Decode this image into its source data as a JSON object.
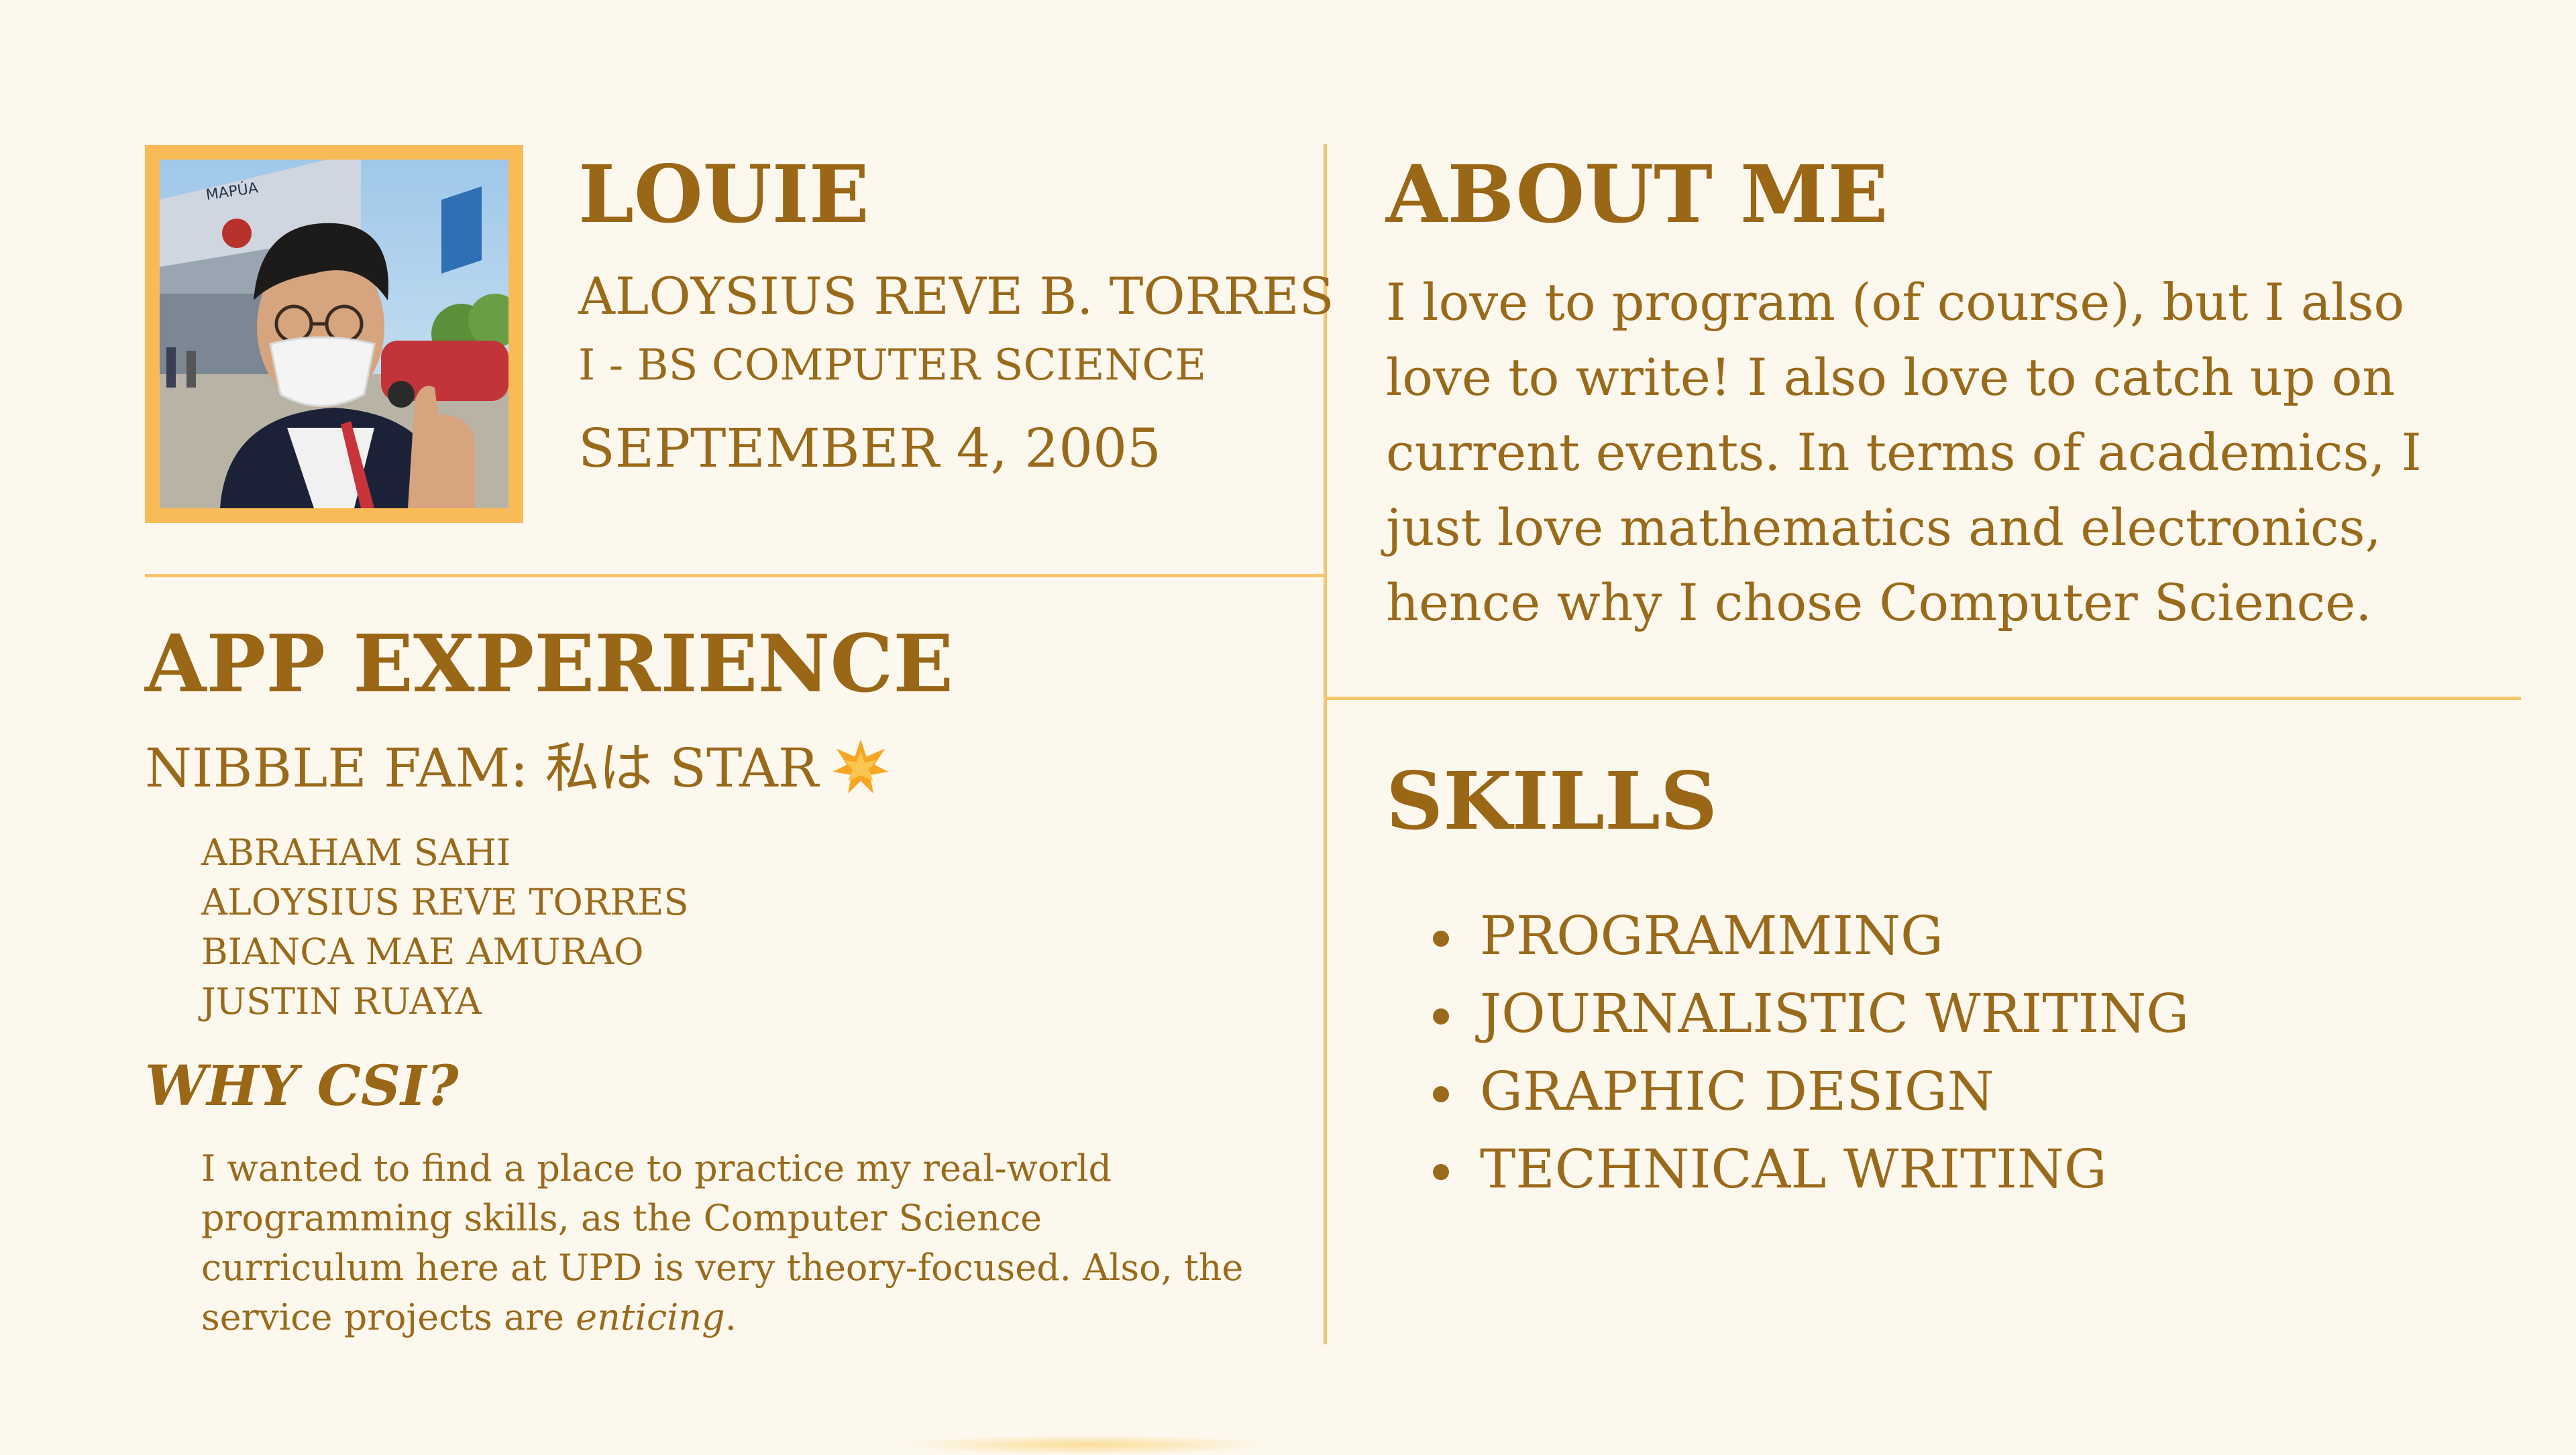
{
  "profile": {
    "nickname": "LOUIE",
    "full_name": "ALOYSIUS REVE B. TORRES",
    "program": "I - BS COMPUTER SCIENCE",
    "birthday": "SEPTEMBER 4, 2005",
    "photo_sign_text": "MAPÚA"
  },
  "about": {
    "title": "ABOUT ME",
    "text": "I love to program (of course), but I also love to write! I also love to catch up on current events. In terms of academics, I just love mathematics and electronics, hence why I chose Computer Science."
  },
  "app_experience": {
    "title": "APP EXPERIENCE",
    "project": "NIBBLE FAM: 私は STAR",
    "project_icon": "star-icon",
    "members": [
      "ABRAHAM SAHI",
      "ALOYSIUS REVE TORRES",
      "BIANCA MAE AMURAO",
      "JUSTIN RUAYA"
    ]
  },
  "why_csi": {
    "title": "WHY CSI?",
    "text_main": "I wanted to find a place to practice my real-world programming skills, as the Computer Science curriculum here at UPD is very theory-focused. Also, the service projects are ",
    "text_emphasis": "enticing",
    "text_end": "."
  },
  "skills": {
    "title": "SKILLS",
    "items": [
      "PROGRAMMING",
      "JOURNALISTIC WRITING",
      "GRAPHIC DESIGN",
      "TECHNICAL WRITING"
    ]
  },
  "colors": {
    "background": "#fdf8ee",
    "text": "#9a6a1b",
    "accent": "#f7c46b",
    "frame": "#f9bb57"
  }
}
